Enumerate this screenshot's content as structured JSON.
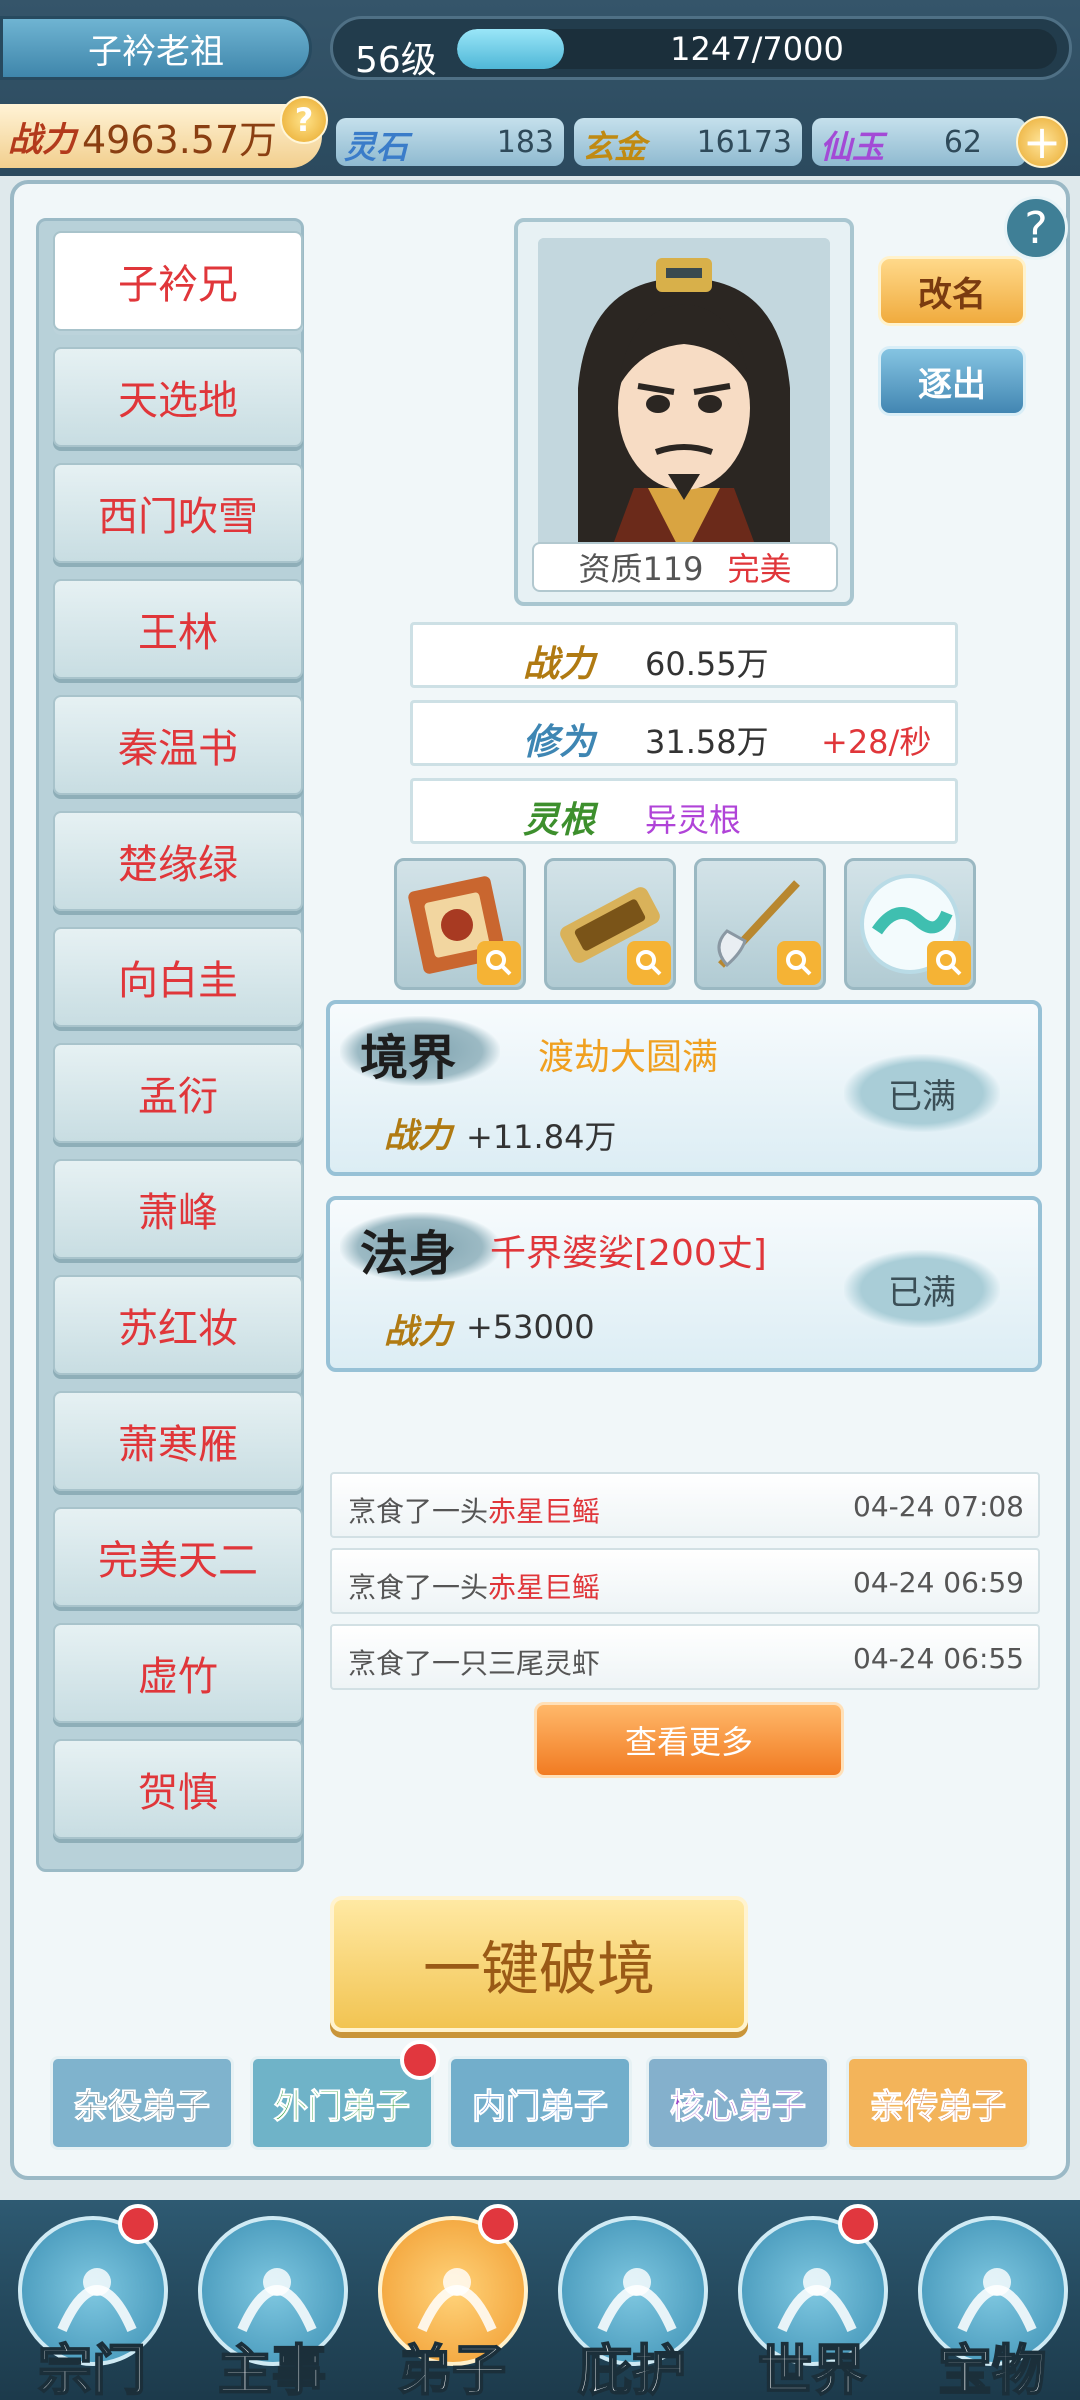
{
  "header": {
    "player_name": "子衿老祖",
    "level": "56级",
    "exp_text": "1247/7000",
    "exp_fraction": 0.178,
    "power_label": "战力",
    "power_value": "4963.57万",
    "help_glyph": "?",
    "resources": [
      {
        "label": "灵石",
        "value": "183",
        "color": "#3a7cc9"
      },
      {
        "label": "玄金",
        "value": "16173",
        "color": "#c08a12"
      },
      {
        "label": "仙玉",
        "value": "62",
        "color": "#a34ad6"
      }
    ],
    "plus_glyph": "+"
  },
  "panel_help_glyph": "?",
  "disciples": [
    {
      "name": "子衿兄",
      "active": true
    },
    {
      "name": "天选地"
    },
    {
      "name": "西门吹雪"
    },
    {
      "name": "王林"
    },
    {
      "name": "秦温书"
    },
    {
      "name": "楚缘绿"
    },
    {
      "name": "向白圭"
    },
    {
      "name": "孟衍"
    },
    {
      "name": "萧峰"
    },
    {
      "name": "苏红妆"
    },
    {
      "name": "萧寒雁"
    },
    {
      "name": "完美天二"
    },
    {
      "name": "虚竹"
    },
    {
      "name": "贺慎"
    }
  ],
  "profile": {
    "aptitude_label": "资质119",
    "aptitude_value": "完美",
    "rename_label": "改名",
    "expel_label": "逐出",
    "stats": [
      {
        "label": "战力",
        "value": "60.55万",
        "extra": "",
        "label_color": "#b07a12",
        "value_color": "#333333"
      },
      {
        "label": "修为",
        "value": "31.58万",
        "extra": "+28/秒",
        "label_color": "#3e86b3",
        "value_color": "#333333"
      },
      {
        "label": "灵根",
        "value": "异灵根",
        "extra": "",
        "label_color": "#3d8f2d",
        "value_color": "#b043d8"
      }
    ],
    "equipment": [
      "token-item-icon",
      "scroll-item-icon",
      "axe-item-icon",
      "orb-item-icon"
    ]
  },
  "cards": [
    {
      "title": "境界",
      "name": "渡劫大圆满",
      "name_color": "#f0a020",
      "power_label": "战力",
      "power_value": "+11.84万",
      "status": "已满"
    },
    {
      "title": "法身",
      "name": "千界婆娑[200丈]",
      "name_color": "#e0363a",
      "power_label": "战力",
      "power_value": "+53000",
      "status": "已满"
    }
  ],
  "logs": [
    {
      "prefix": "烹食了一头",
      "highlight": "赤星巨鳐",
      "time": "04-24 07:08"
    },
    {
      "prefix": "烹食了一头",
      "highlight": "赤星巨鳐",
      "time": "04-24 06:59"
    },
    {
      "prefix": "烹食了一只三尾灵虾",
      "highlight": "",
      "time": "04-24 06:55"
    }
  ],
  "view_more_label": "查看更多",
  "breakthrough_label": "一键破境",
  "tiers": [
    {
      "label": "杂役弟子",
      "bg": "#7fb3cd",
      "color": "#2c4b5a",
      "dot": false
    },
    {
      "label": "外门弟子",
      "bg": "#6fb3c8",
      "color": "#2f9c3a",
      "dot": true
    },
    {
      "label": "内门弟子",
      "bg": "#72aecb",
      "color": "#3a7cc9",
      "dot": false
    },
    {
      "label": "核心弟子",
      "bg": "#84b0cc",
      "color": "#9a45c8",
      "dot": false
    },
    {
      "label": "亲传弟子",
      "bg": "#f3b45a",
      "color": "#c0501a",
      "dot": false
    }
  ],
  "nav": [
    {
      "label": "宗门",
      "icon": "sect-gate-icon",
      "dot": true,
      "active": false
    },
    {
      "label": "主事",
      "icon": "task-checklist-icon",
      "dot": false,
      "active": false
    },
    {
      "label": "弟子",
      "icon": "disciple-icon",
      "dot": true,
      "active": true
    },
    {
      "label": "庇护",
      "icon": "shelter-bird-icon",
      "dot": false,
      "active": false
    },
    {
      "label": "世界",
      "icon": "world-scroll-icon",
      "dot": true,
      "active": false
    },
    {
      "label": "宝物",
      "icon": "treasure-bag-icon",
      "dot": false,
      "active": false
    }
  ]
}
